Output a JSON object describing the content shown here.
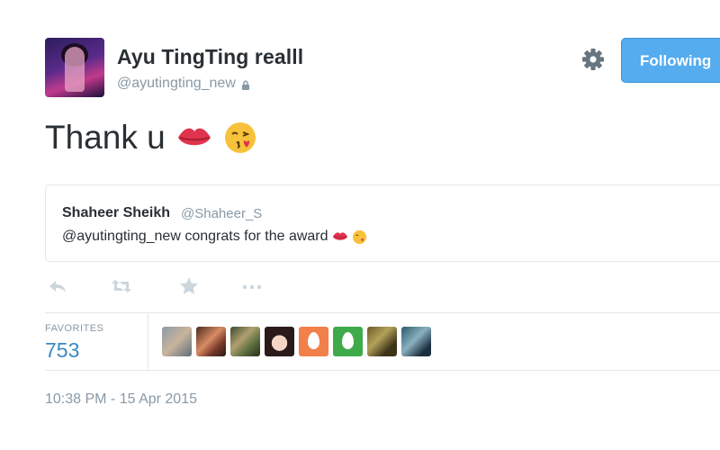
{
  "profile": {
    "display_name": "Ayu TingTing realll",
    "handle": "@ayutingting_new",
    "protected_icon": "lock-icon",
    "follow_button_label": "Following",
    "settings_icon": "gear-icon"
  },
  "tweet": {
    "text": "Thank u",
    "emojis": [
      "kiss-mark-emoji",
      "face-blowing-kiss-emoji"
    ]
  },
  "quoted_tweet": {
    "name": "Shaheer Sheikh",
    "handle": "@Shaheer_S",
    "text": "@ayutingting_new congrats for the award",
    "emojis": [
      "kiss-mark-emoji",
      "face-blowing-kiss-emoji"
    ]
  },
  "actions": [
    "reply-icon",
    "retweet-icon",
    "favorite-star-icon",
    "more-dots-icon"
  ],
  "stats": {
    "favorites_label": "FAVORITES",
    "favorites_count": "753"
  },
  "favoriters": [
    {
      "icon": "avatar-photo"
    },
    {
      "icon": "avatar-photo"
    },
    {
      "icon": "avatar-photo"
    },
    {
      "icon": "avatar-photo"
    },
    {
      "icon": "default-egg-avatar"
    },
    {
      "icon": "default-egg-avatar"
    },
    {
      "icon": "avatar-photo"
    },
    {
      "icon": "avatar-photo"
    }
  ],
  "timestamp": "10:38 PM - 15 Apr 2015",
  "colors": {
    "accent_blue": "#55acee",
    "count_blue": "#3b88c3",
    "muted_text": "#8899a6",
    "egg_orange": "#f2804a",
    "egg_green": "#3faa4a"
  }
}
